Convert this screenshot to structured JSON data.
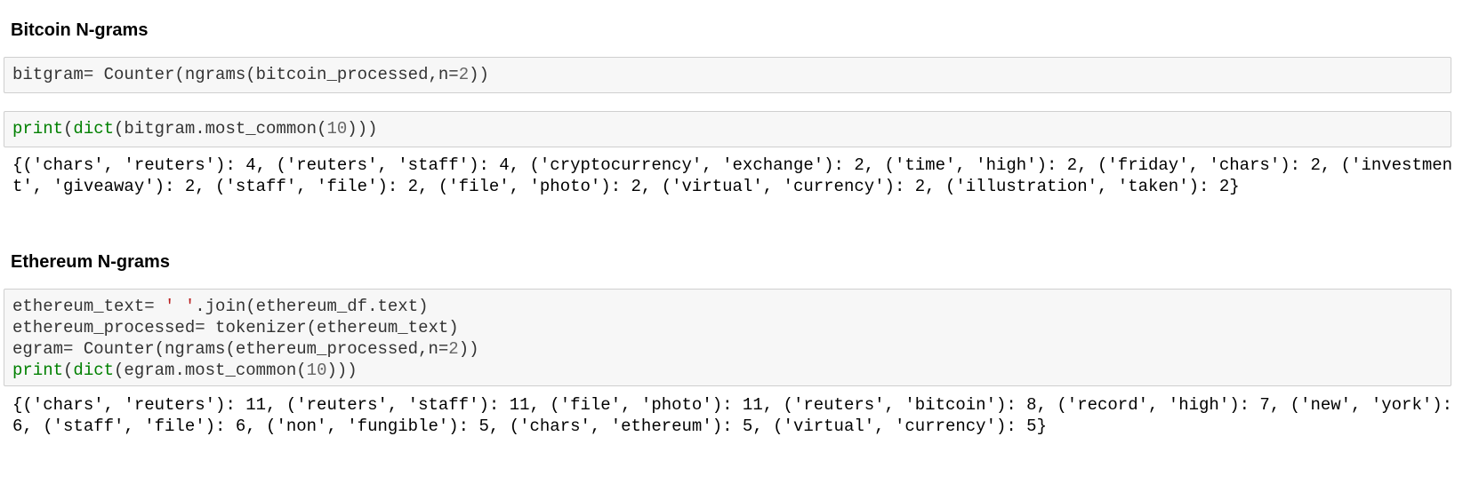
{
  "section1": {
    "heading": "Bitcoin N-grams",
    "cell1": {
      "line1": {
        "a": "bitgram= Counter(ngrams(bitcoin_processed,n=",
        "n": "2",
        "b": "))"
      }
    },
    "cell2": {
      "line1": {
        "kw1": "print",
        "p1": "(",
        "kw2": "dict",
        "p2": "(bitgram.most_common(",
        "n": "10",
        "p3": ")))"
      }
    },
    "output": "{('chars', 'reuters'): 4, ('reuters', 'staff'): 4, ('cryptocurrency', 'exchange'): 2, ('time', 'high'): 2, ('friday', 'chars'): 2, ('investment', 'giveaway'): 2, ('staff', 'file'): 2, ('file', 'photo'): 2, ('virtual', 'currency'): 2, ('illustration', 'taken'): 2}"
  },
  "section2": {
    "heading": "Ethereum N-grams",
    "cell": {
      "line1": {
        "a": "ethereum_text= ",
        "s": "' '",
        "b": ".join(ethereum_df.text)"
      },
      "line2": {
        "a": "ethereum_processed= tokenizer(ethereum_text)"
      },
      "line3": {
        "a": "egram= Counter(ngrams(ethereum_processed,n=",
        "n": "2",
        "b": "))"
      },
      "line4": {
        "kw1": "print",
        "p1": "(",
        "kw2": "dict",
        "p2": "(egram.most_common(",
        "n": "10",
        "p3": ")))"
      }
    },
    "output": "{('chars', 'reuters'): 11, ('reuters', 'staff'): 11, ('file', 'photo'): 11, ('reuters', 'bitcoin'): 8, ('record', 'high'): 7, ('new', 'york'): 6, ('staff', 'file'): 6, ('non', 'fungible'): 5, ('chars', 'ethereum'): 5, ('virtual', 'currency'): 5}"
  }
}
